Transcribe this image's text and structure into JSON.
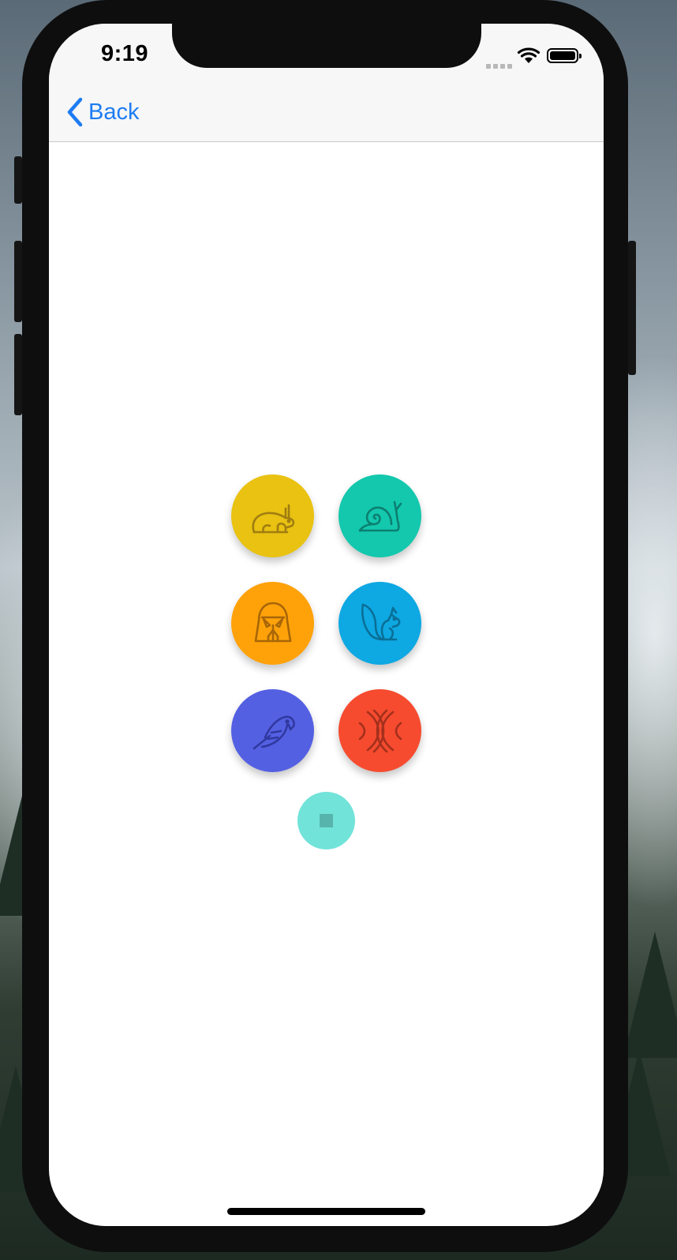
{
  "status_bar": {
    "time": "9:19"
  },
  "nav": {
    "back_label": "Back"
  },
  "colors": {
    "accent": "#1e7cf2",
    "rabbit": "#e9c212",
    "snail": "#13c8ad",
    "helmet": "#ffa20a",
    "squirrel": "#0ea8e3",
    "parrot": "#5460e2",
    "waves": "#f64b2f",
    "stop": "#72e3d9"
  },
  "grid": {
    "items": [
      {
        "icon": "rabbit-icon"
      },
      {
        "icon": "snail-icon"
      },
      {
        "icon": "vader-helmet-icon"
      },
      {
        "icon": "squirrel-icon"
      },
      {
        "icon": "parrot-icon"
      },
      {
        "icon": "waves-icon"
      }
    ],
    "stop_icon": "stop-icon"
  }
}
